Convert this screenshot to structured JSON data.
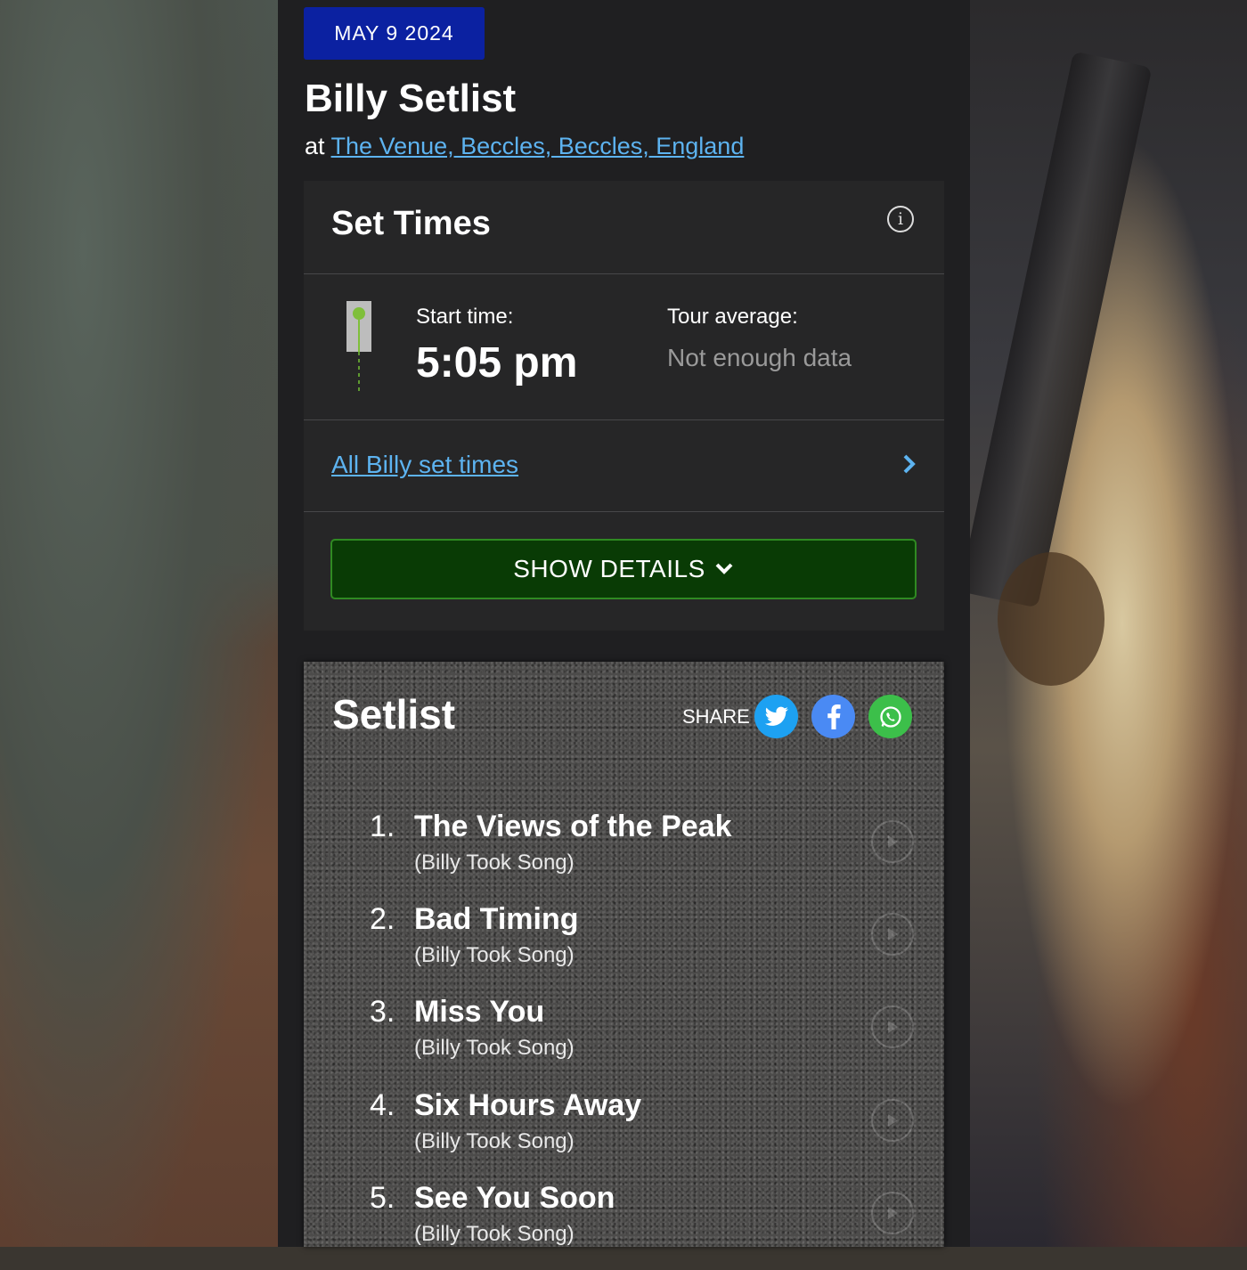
{
  "header": {
    "date_badge": "MAY 9 2024",
    "title": "Billy Setlist",
    "venue_prefix": "at",
    "venue_link": "The Venue, Beccles, Beccles, England"
  },
  "set_times": {
    "title": "Set Times",
    "info_icon": "info-icon",
    "start_label": "Start time:",
    "start_time": "5:05 pm",
    "tour_avg_label": "Tour average:",
    "tour_avg_value": "Not enough data",
    "all_times_link": "All Billy set times",
    "show_details_label": "SHOW DETAILS"
  },
  "setlist": {
    "title": "Setlist",
    "share_label": "SHARE",
    "share_buttons": [
      {
        "name": "twitter-icon",
        "color": "#1da1f2"
      },
      {
        "name": "facebook-icon",
        "color": "#4a8af4"
      },
      {
        "name": "whatsapp-icon",
        "color": "#3cbf4a"
      }
    ],
    "songs": [
      {
        "num": "1.",
        "name": "The Views of the Peak",
        "sub": "(Billy Took Song)"
      },
      {
        "num": "2.",
        "name": "Bad Timing",
        "sub": "(Billy Took Song)"
      },
      {
        "num": "3.",
        "name": "Miss You",
        "sub": "(Billy Took Song)"
      },
      {
        "num": "4.",
        "name": "Six Hours Away",
        "sub": "(Billy Took Song)"
      },
      {
        "num": "5.",
        "name": "See You Soon",
        "sub": "(Billy Took Song)"
      }
    ]
  },
  "colors": {
    "accent_link": "#5db3f0",
    "date_badge_bg": "#0b21a1",
    "show_details_bg": "#093b05",
    "page_bg": "#1f1f21"
  }
}
